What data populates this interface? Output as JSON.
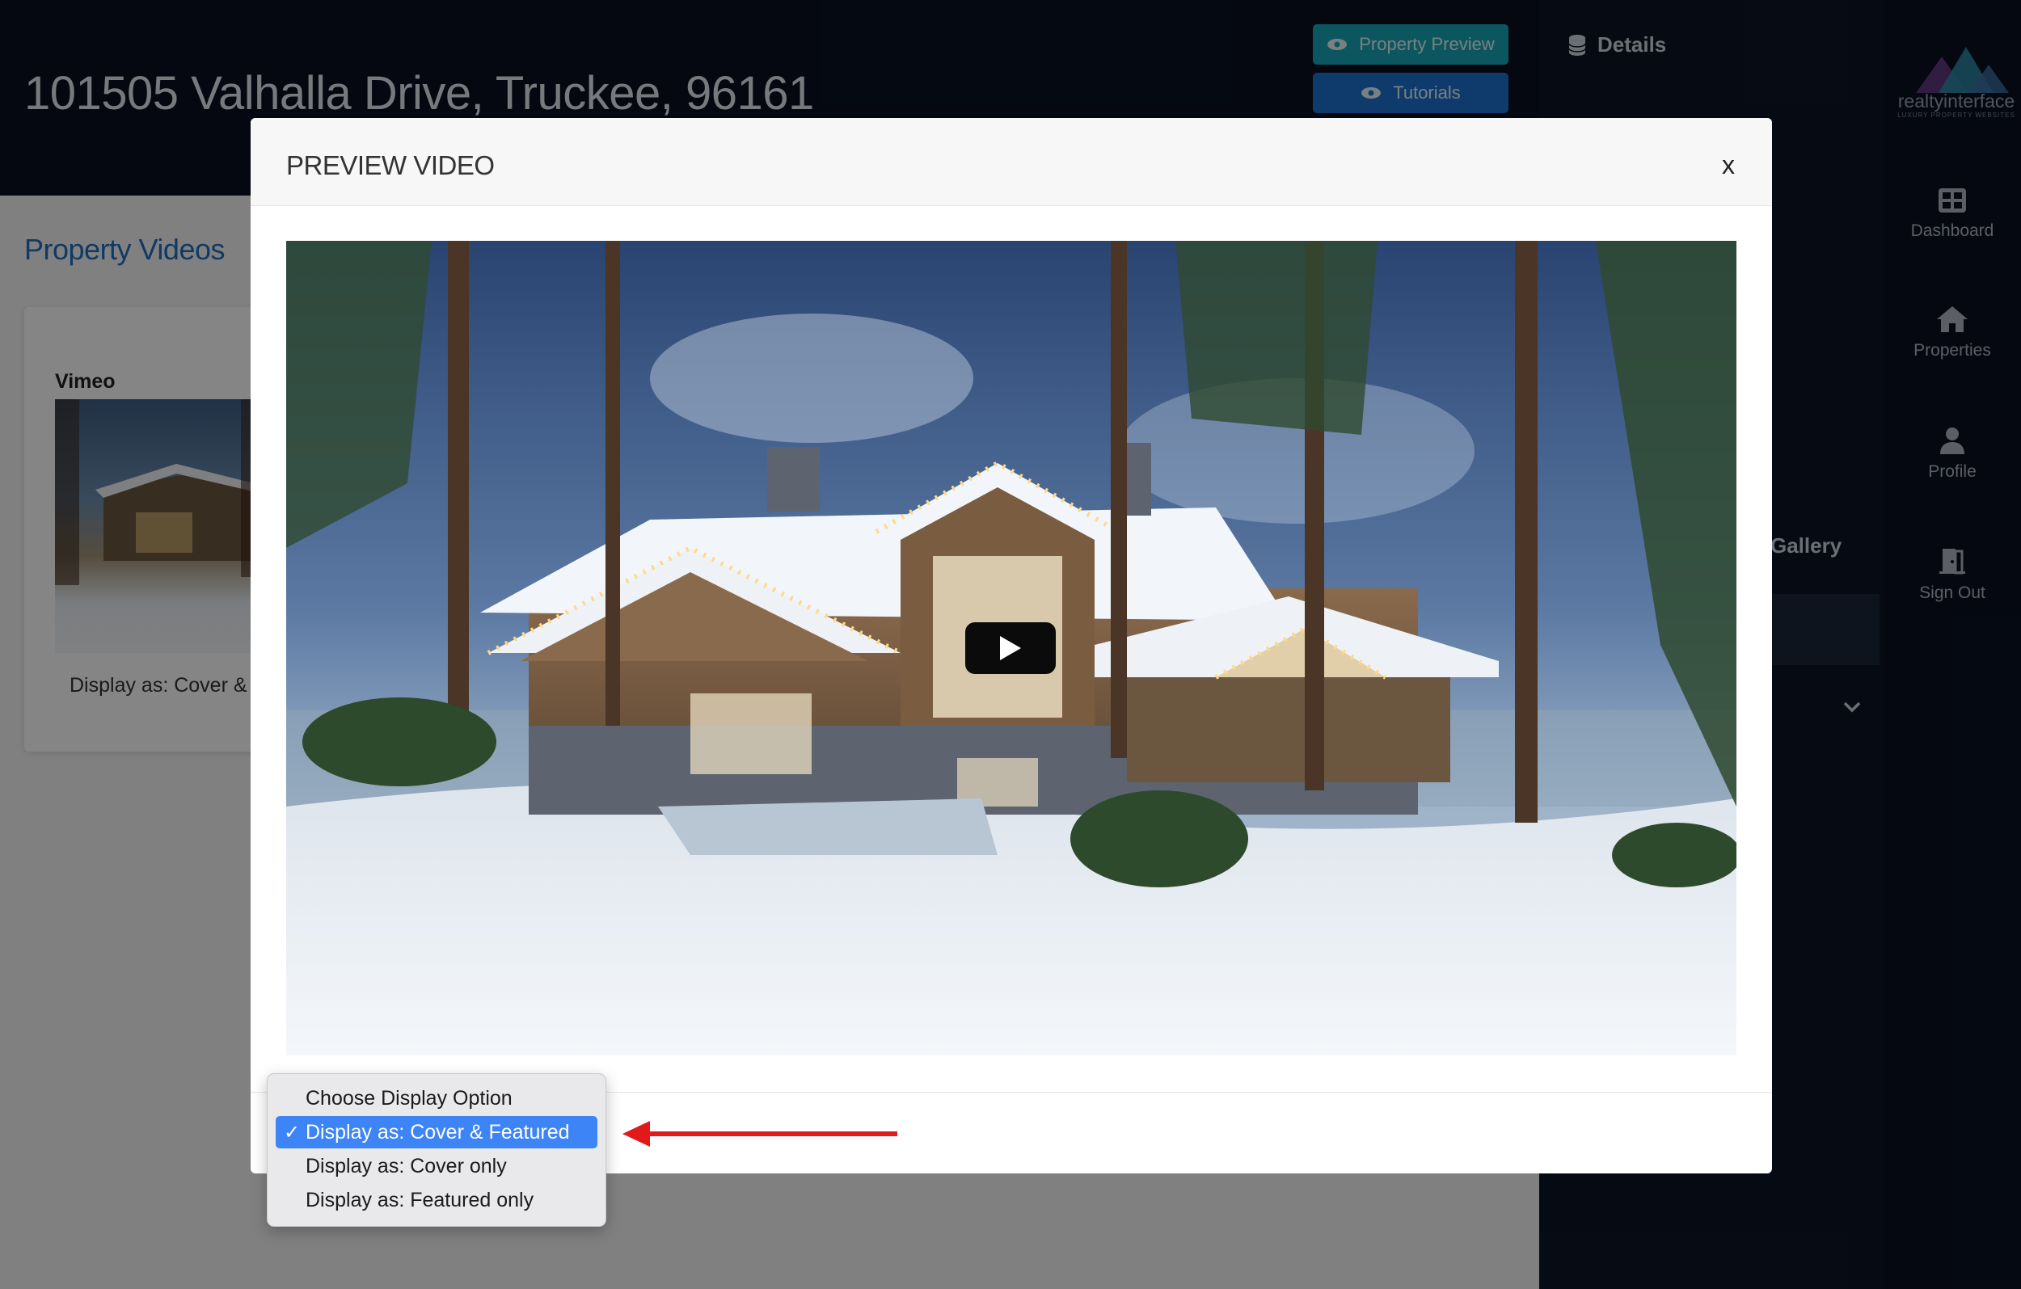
{
  "page": {
    "address": "101505 Valhalla Drive, Truckee, 96161",
    "section_title": "Property Videos"
  },
  "header": {
    "property_preview_label": "Property Preview",
    "tutorials_label": "Tutorials",
    "details_label": "Details"
  },
  "video_card": {
    "provider": "Vimeo",
    "display_text": "Display as:    Cover &"
  },
  "right_panel": {
    "gallery_label": "Gallery"
  },
  "brand": {
    "name": "realtyinterface",
    "tagline": "LUXURY PROPERTY WEBSITES"
  },
  "sidebar": {
    "items": [
      {
        "label": "Dashboard",
        "icon": "dashboard-icon"
      },
      {
        "label": "Properties",
        "icon": "home-icon"
      },
      {
        "label": "Profile",
        "icon": "user-icon"
      },
      {
        "label": "Sign Out",
        "icon": "door-icon"
      }
    ]
  },
  "modal": {
    "title": "PREVIEW VIDEO",
    "close_label": "x"
  },
  "display_select": {
    "options": [
      "Choose Display Option",
      "Display as: Cover & Featured",
      "Display as: Cover only",
      "Display as: Featured only"
    ],
    "selected": "Display as: Cover & Featured",
    "check": "✓"
  },
  "colors": {
    "accent_blue": "#1e6fd0",
    "accent_teal": "#17a8b6",
    "select_highlight": "#3d84f6",
    "annotation_red": "#e01a1a",
    "dark_bg": "#0a1120"
  }
}
